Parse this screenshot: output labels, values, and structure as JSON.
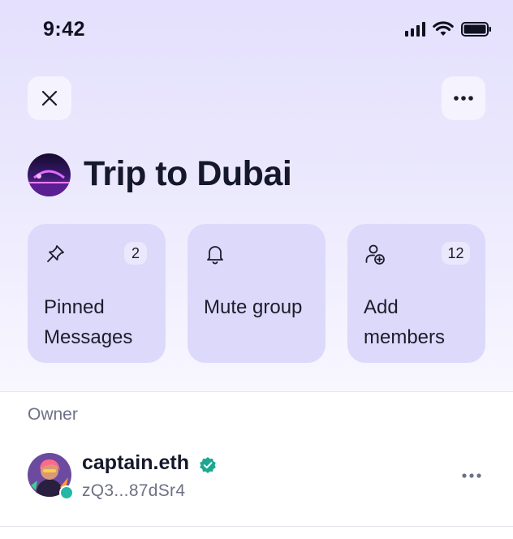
{
  "status_bar": {
    "time": "9:42"
  },
  "header": {
    "close_icon": "close-icon",
    "more_icon": "more-horizontal-icon"
  },
  "group": {
    "title": "Trip to Dubai"
  },
  "cards": [
    {
      "id": "pinned",
      "icon": "pin-icon",
      "label": "Pinned Messages",
      "badge": "2"
    },
    {
      "id": "mute",
      "icon": "bell-icon",
      "label": "Mute group"
    },
    {
      "id": "add",
      "icon": "add-user-icon",
      "label": "Add members",
      "badge": "12"
    }
  ],
  "members_section": {
    "label": "Owner",
    "members": [
      {
        "name": "captain.eth",
        "address": "zQ3...87dSr4",
        "verified": true,
        "online": true
      }
    ]
  },
  "colors": {
    "card_bg": "#ddd9fb",
    "verified": "#1aa88f",
    "online": "#22b8a6"
  }
}
